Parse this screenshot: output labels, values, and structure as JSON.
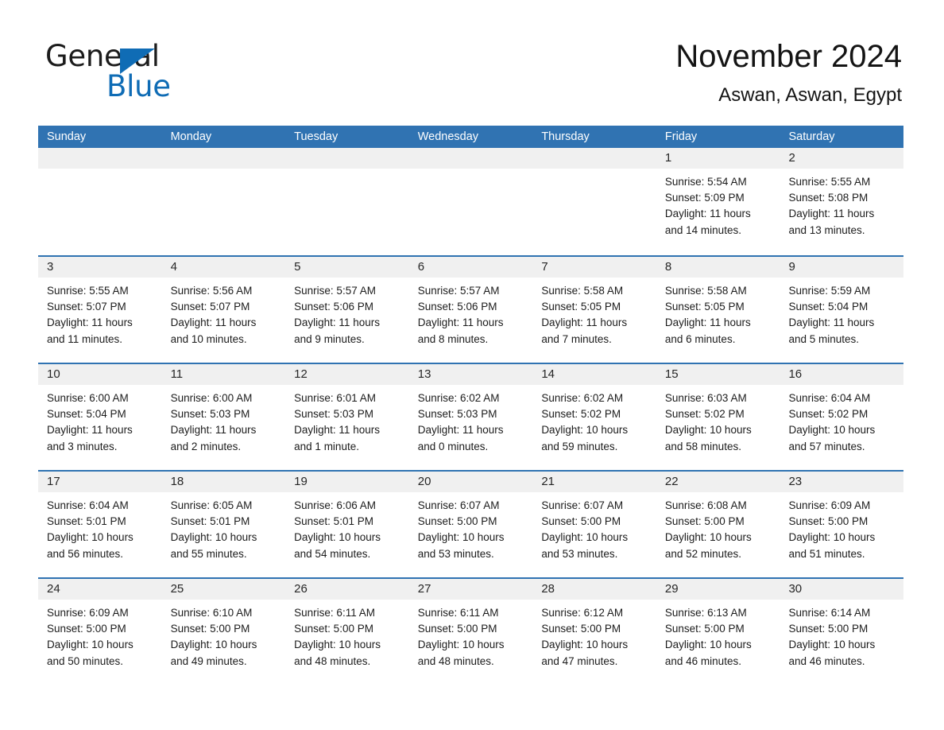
{
  "brand": {
    "name_part1": "General",
    "name_part2": "Blue",
    "triangle_color": "#0f6cb5",
    "text_color": "#1c1c1c"
  },
  "header": {
    "title": "November 2024",
    "subtitle": "Aswan, Aswan, Egypt"
  },
  "calendar": {
    "header_color": "#3073b2",
    "band_color": "#f0f0f0",
    "weekdays": [
      "Sunday",
      "Monday",
      "Tuesday",
      "Wednesday",
      "Thursday",
      "Friday",
      "Saturday"
    ],
    "weeks": [
      [
        {
          "day": "",
          "lines": []
        },
        {
          "day": "",
          "lines": []
        },
        {
          "day": "",
          "lines": []
        },
        {
          "day": "",
          "lines": []
        },
        {
          "day": "",
          "lines": []
        },
        {
          "day": "1",
          "lines": [
            "Sunrise: 5:54 AM",
            "Sunset: 5:09 PM",
            "Daylight: 11 hours",
            "and 14 minutes."
          ]
        },
        {
          "day": "2",
          "lines": [
            "Sunrise: 5:55 AM",
            "Sunset: 5:08 PM",
            "Daylight: 11 hours",
            "and 13 minutes."
          ]
        }
      ],
      [
        {
          "day": "3",
          "lines": [
            "Sunrise: 5:55 AM",
            "Sunset: 5:07 PM",
            "Daylight: 11 hours",
            "and 11 minutes."
          ]
        },
        {
          "day": "4",
          "lines": [
            "Sunrise: 5:56 AM",
            "Sunset: 5:07 PM",
            "Daylight: 11 hours",
            "and 10 minutes."
          ]
        },
        {
          "day": "5",
          "lines": [
            "Sunrise: 5:57 AM",
            "Sunset: 5:06 PM",
            "Daylight: 11 hours",
            "and 9 minutes."
          ]
        },
        {
          "day": "6",
          "lines": [
            "Sunrise: 5:57 AM",
            "Sunset: 5:06 PM",
            "Daylight: 11 hours",
            "and 8 minutes."
          ]
        },
        {
          "day": "7",
          "lines": [
            "Sunrise: 5:58 AM",
            "Sunset: 5:05 PM",
            "Daylight: 11 hours",
            "and 7 minutes."
          ]
        },
        {
          "day": "8",
          "lines": [
            "Sunrise: 5:58 AM",
            "Sunset: 5:05 PM",
            "Daylight: 11 hours",
            "and 6 minutes."
          ]
        },
        {
          "day": "9",
          "lines": [
            "Sunrise: 5:59 AM",
            "Sunset: 5:04 PM",
            "Daylight: 11 hours",
            "and 5 minutes."
          ]
        }
      ],
      [
        {
          "day": "10",
          "lines": [
            "Sunrise: 6:00 AM",
            "Sunset: 5:04 PM",
            "Daylight: 11 hours",
            "and 3 minutes."
          ]
        },
        {
          "day": "11",
          "lines": [
            "Sunrise: 6:00 AM",
            "Sunset: 5:03 PM",
            "Daylight: 11 hours",
            "and 2 minutes."
          ]
        },
        {
          "day": "12",
          "lines": [
            "Sunrise: 6:01 AM",
            "Sunset: 5:03 PM",
            "Daylight: 11 hours",
            "and 1 minute."
          ]
        },
        {
          "day": "13",
          "lines": [
            "Sunrise: 6:02 AM",
            "Sunset: 5:03 PM",
            "Daylight: 11 hours",
            "and 0 minutes."
          ]
        },
        {
          "day": "14",
          "lines": [
            "Sunrise: 6:02 AM",
            "Sunset: 5:02 PM",
            "Daylight: 10 hours",
            "and 59 minutes."
          ]
        },
        {
          "day": "15",
          "lines": [
            "Sunrise: 6:03 AM",
            "Sunset: 5:02 PM",
            "Daylight: 10 hours",
            "and 58 minutes."
          ]
        },
        {
          "day": "16",
          "lines": [
            "Sunrise: 6:04 AM",
            "Sunset: 5:02 PM",
            "Daylight: 10 hours",
            "and 57 minutes."
          ]
        }
      ],
      [
        {
          "day": "17",
          "lines": [
            "Sunrise: 6:04 AM",
            "Sunset: 5:01 PM",
            "Daylight: 10 hours",
            "and 56 minutes."
          ]
        },
        {
          "day": "18",
          "lines": [
            "Sunrise: 6:05 AM",
            "Sunset: 5:01 PM",
            "Daylight: 10 hours",
            "and 55 minutes."
          ]
        },
        {
          "day": "19",
          "lines": [
            "Sunrise: 6:06 AM",
            "Sunset: 5:01 PM",
            "Daylight: 10 hours",
            "and 54 minutes."
          ]
        },
        {
          "day": "20",
          "lines": [
            "Sunrise: 6:07 AM",
            "Sunset: 5:00 PM",
            "Daylight: 10 hours",
            "and 53 minutes."
          ]
        },
        {
          "day": "21",
          "lines": [
            "Sunrise: 6:07 AM",
            "Sunset: 5:00 PM",
            "Daylight: 10 hours",
            "and 53 minutes."
          ]
        },
        {
          "day": "22",
          "lines": [
            "Sunrise: 6:08 AM",
            "Sunset: 5:00 PM",
            "Daylight: 10 hours",
            "and 52 minutes."
          ]
        },
        {
          "day": "23",
          "lines": [
            "Sunrise: 6:09 AM",
            "Sunset: 5:00 PM",
            "Daylight: 10 hours",
            "and 51 minutes."
          ]
        }
      ],
      [
        {
          "day": "24",
          "lines": [
            "Sunrise: 6:09 AM",
            "Sunset: 5:00 PM",
            "Daylight: 10 hours",
            "and 50 minutes."
          ]
        },
        {
          "day": "25",
          "lines": [
            "Sunrise: 6:10 AM",
            "Sunset: 5:00 PM",
            "Daylight: 10 hours",
            "and 49 minutes."
          ]
        },
        {
          "day": "26",
          "lines": [
            "Sunrise: 6:11 AM",
            "Sunset: 5:00 PM",
            "Daylight: 10 hours",
            "and 48 minutes."
          ]
        },
        {
          "day": "27",
          "lines": [
            "Sunrise: 6:11 AM",
            "Sunset: 5:00 PM",
            "Daylight: 10 hours",
            "and 48 minutes."
          ]
        },
        {
          "day": "28",
          "lines": [
            "Sunrise: 6:12 AM",
            "Sunset: 5:00 PM",
            "Daylight: 10 hours",
            "and 47 minutes."
          ]
        },
        {
          "day": "29",
          "lines": [
            "Sunrise: 6:13 AM",
            "Sunset: 5:00 PM",
            "Daylight: 10 hours",
            "and 46 minutes."
          ]
        },
        {
          "day": "30",
          "lines": [
            "Sunrise: 6:14 AM",
            "Sunset: 5:00 PM",
            "Daylight: 10 hours",
            "and 46 minutes."
          ]
        }
      ]
    ]
  }
}
